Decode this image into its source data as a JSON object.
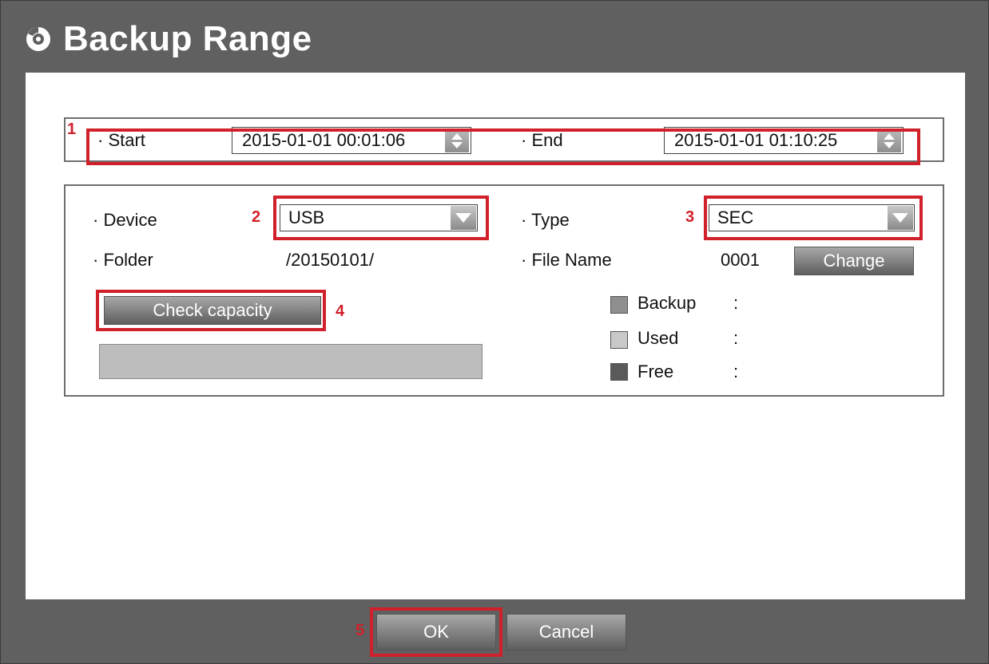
{
  "dialog": {
    "title": "Backup Range"
  },
  "range": {
    "start_label": "· Start",
    "start_value": "2015-01-01 00:01:06",
    "end_label": "· End",
    "end_value": "2015-01-01 01:10:25"
  },
  "settings": {
    "device_label": "· Device",
    "device_value": "USB",
    "type_label": "· Type",
    "type_value": "SEC",
    "folder_label": "· Folder",
    "folder_value": "/20150101/",
    "filename_label": "· File Name",
    "filename_value": "0001",
    "change_button": "Change",
    "check_capacity_button": "Check capacity"
  },
  "capacity_legend": [
    {
      "label": "Backup",
      "sep": ":",
      "color": "#8f8f8f"
    },
    {
      "label": "Used",
      "sep": ":",
      "color": "#c8c8c8"
    },
    {
      "label": "Free",
      "sep": ":",
      "color": "#5a5a5a"
    }
  ],
  "footer": {
    "ok_button": "OK",
    "cancel_button": "Cancel"
  },
  "callouts": [
    "1",
    "2",
    "3",
    "4",
    "5"
  ],
  "colors": {
    "window_bg": "#606060",
    "callout": "#d0202a",
    "button_top": "#a8a8a8",
    "button_bottom": "#5e5e5e"
  }
}
